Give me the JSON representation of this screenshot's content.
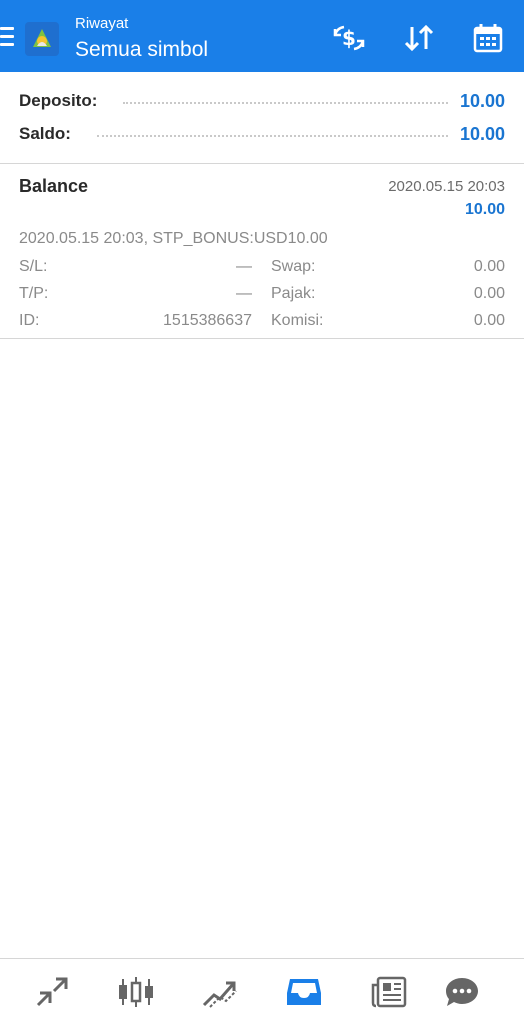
{
  "header": {
    "subtitle": "Riwayat",
    "title": "Semua simbol",
    "accent": "#1a7fe8"
  },
  "summary": {
    "rows": [
      {
        "label": "Deposito:",
        "value": "10.00"
      },
      {
        "label": "Saldo:",
        "value": "10.00"
      }
    ]
  },
  "entry": {
    "title": "Balance",
    "time": "2020.05.15 20:03",
    "amount": "10.00",
    "comment": "2020.05.15 20:03, STP_BONUS:USD10.00",
    "sl_label": "S/L:",
    "sl_value": "—",
    "tp_label": "T/P:",
    "tp_value": "—",
    "id_label": "ID:",
    "id_value": "1515386637",
    "swap_label": "Swap:",
    "swap_value": "0.00",
    "tax_label": "Pajak:",
    "tax_value": "0.00",
    "commission_label": "Komisi:",
    "commission_value": "0.00"
  },
  "icons": {
    "menu": "menu-icon",
    "logo": "app-logo",
    "currency": "currency-exchange-icon",
    "sort": "sort-icon",
    "calendar": "calendar-icon",
    "quotes": "quotes-icon",
    "chart": "candlestick-chart-icon",
    "trade": "trade-icon",
    "history": "history-inbox-icon",
    "news": "news-icon",
    "chat": "chat-icon"
  },
  "colors": {
    "value_blue": "#1a75d1",
    "nav_active": "#1a7fe8",
    "nav_inactive": "#666666"
  }
}
